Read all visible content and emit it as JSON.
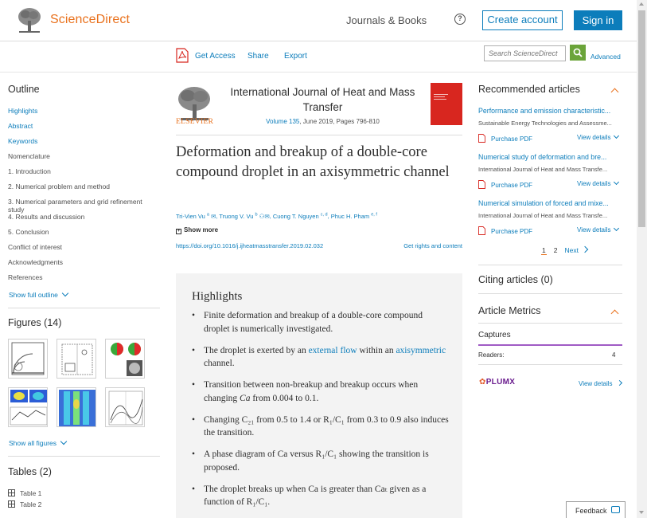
{
  "header": {
    "brand": "ScienceDirect",
    "journals_books": "Journals & Books",
    "help_glyph": "?",
    "create_account": "Create account",
    "sign_in": "Sign in"
  },
  "toolbar": {
    "get_access": "Get Access",
    "share": "Share",
    "export": "Export",
    "search_placeholder": "Search ScienceDirect",
    "advanced": "Advanced"
  },
  "outline": {
    "title": "Outline",
    "items": [
      {
        "label": "Highlights"
      },
      {
        "label": "Abstract"
      },
      {
        "label": "Keywords"
      },
      {
        "label": "Nomenclature"
      },
      {
        "label": "1. Introduction"
      },
      {
        "label": "2. Numerical problem and method"
      },
      {
        "label": "3. Numerical parameters and grid refinement study"
      },
      {
        "label": "4. Results and discussion"
      },
      {
        "label": "5. Conclusion"
      },
      {
        "label": "Conflict of interest"
      },
      {
        "label": "Acknowledgments"
      },
      {
        "label": "References"
      }
    ],
    "show_full": "Show full outline"
  },
  "figures": {
    "title": "Figures (14)",
    "show_all": "Show all figures"
  },
  "tables": {
    "title": "Tables (2)",
    "items": [
      "Table 1",
      "Table 2"
    ]
  },
  "journal": {
    "publisher": "ELSEVIER",
    "name": "International Journal of Heat and Mass Transfer",
    "volume": "Volume 135",
    "issue_pages": ", June 2019, Pages 796-810"
  },
  "article": {
    "title": "Deformation and breakup of a double-core compound droplet in an axisymmetric channel",
    "authors": [
      {
        "name": "Tri-Vien Vu",
        "sup": "a"
      },
      {
        "name": "Truong V. Vu",
        "sup": "b"
      },
      {
        "name": "Cuong T. Nguyen",
        "sup": "c, d"
      },
      {
        "name": "Phuc H. Pham",
        "sup": "e, f"
      }
    ],
    "show_more": "Show more",
    "doi": "https://doi.org/10.1016/j.ijheatmasstransfer.2019.02.032",
    "rights": "Get rights and content"
  },
  "highlights": {
    "title": "Highlights",
    "items": [
      {
        "text": "Finite deformation and breakup of a double-core compound droplet is numerically investigated."
      },
      {
        "pre": "The droplet is exerted by an ",
        "link1": "external flow",
        "mid": " within an ",
        "link2": "axisymmetric",
        "post": " channel."
      },
      {
        "pre": "Transition between non-breakup and breakup occurs when changing ",
        "em": "Ca",
        "post": " from 0.004 to 0.1."
      },
      {
        "text": "Changing C₂₁ from 0.5 to 1.4 or R₁/C₁ from 0.3 to 0.9 also induces the transition."
      },
      {
        "text": "A phase diagram of Ca versus R₁/C₁ showing the transition is proposed."
      },
      {
        "text": "The droplet breaks up when Ca is greater than Caₜ given as a function of R₁/C₁."
      }
    ]
  },
  "recommended": {
    "title": "Recommended articles",
    "items": [
      {
        "title": "Performance and emission characteristic...",
        "source": "Sustainable Energy Technologies and Assessme...",
        "pdf": "Purchase PDF",
        "view": "View details"
      },
      {
        "title": "Numerical study of deformation and bre...",
        "source": "International Journal of Heat and Mass Transfe...",
        "pdf": "Purchase PDF",
        "view": "View details"
      },
      {
        "title": "Numerical simulation of forced and mixe...",
        "source": "International Journal of Heat and Mass Transfe...",
        "pdf": "Purchase PDF",
        "view": "View details"
      }
    ],
    "pager": {
      "page1": "1",
      "page2": "2",
      "next": "Next"
    }
  },
  "citing": {
    "title": "Citing articles (0)"
  },
  "metrics": {
    "title": "Article Metrics",
    "captures": "Captures",
    "readers_label": "Readers:",
    "readers_value": "4",
    "plumx": "PLUMX",
    "view_details": "View details"
  },
  "feedback": {
    "label": "Feedback"
  },
  "colors": {
    "brand_orange": "#e9711c",
    "link_blue": "#0c7dbb",
    "search_green": "#6ba43a"
  }
}
